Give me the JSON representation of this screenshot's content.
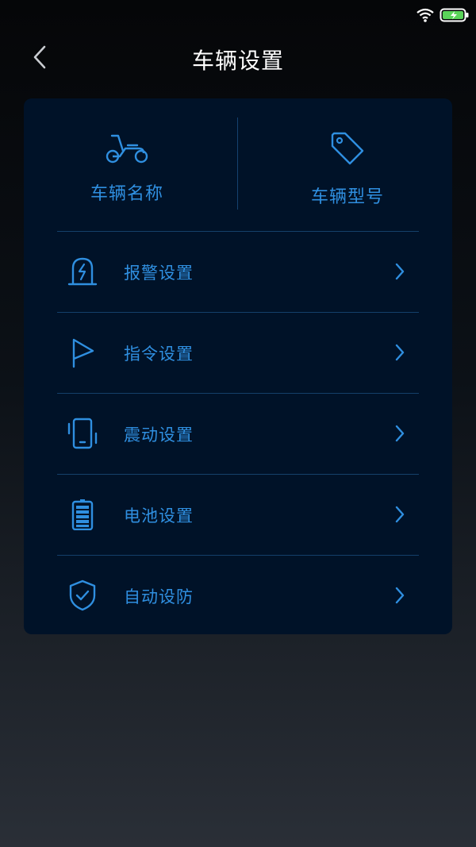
{
  "header": {
    "title": "车辆设置",
    "back_icon": "chevron-left-icon"
  },
  "status_bar": {
    "icons": [
      "wifi-icon",
      "battery-charging-icon"
    ]
  },
  "top_items": [
    {
      "label": "车辆名称",
      "icon": "scooter-icon"
    },
    {
      "label": "车辆型号",
      "icon": "tag-icon"
    }
  ],
  "menu": [
    {
      "label": "报警设置",
      "icon": "alarm-icon"
    },
    {
      "label": "指令设置",
      "icon": "flag-icon"
    },
    {
      "label": "震动设置",
      "icon": "vibration-icon"
    },
    {
      "label": "电池设置",
      "icon": "battery-icon"
    },
    {
      "label": "自动设防",
      "icon": "shield-check-icon"
    }
  ],
  "colors": {
    "accent": "#2f8fe0",
    "card_bg": "#001228",
    "divider": "#14406a",
    "title": "#ffffff"
  }
}
